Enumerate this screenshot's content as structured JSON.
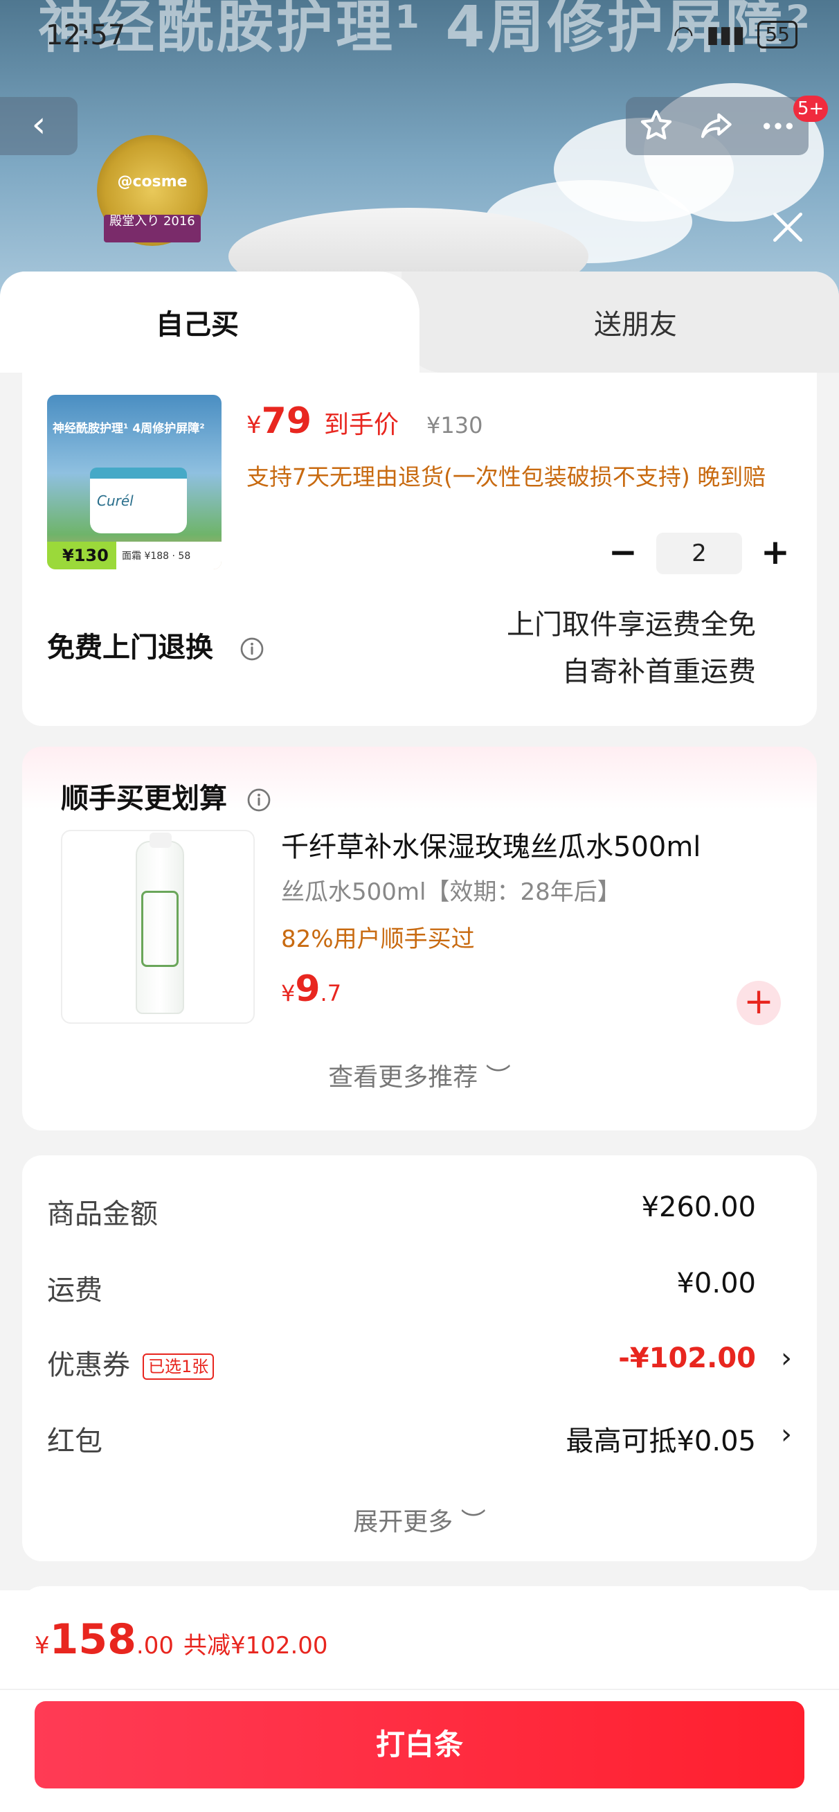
{
  "status_bar": {
    "time": "12:57",
    "battery": "55"
  },
  "banner": {
    "title": "神经酰胺护理¹ 4周修护屏障²",
    "badge_text": "@cosme",
    "badge_ribbon": "殿堂入り 2016"
  },
  "nav": {
    "back_icon": "chevron-left-icon",
    "more_count": "5+"
  },
  "tabs": {
    "self": "自己买",
    "gift": "送朋友"
  },
  "product": {
    "thumb_title": "神经酰胺护理¹ 4周修护屏障²",
    "thumb_brand": "Curél",
    "thumb_price": "¥130",
    "thumb_sub": "面霜 ¥188 · 58",
    "price_currency": "¥",
    "price": "79",
    "price_tag": "到手价",
    "original_price": "¥130",
    "return_note": "支持7天无理由退货(一次性包装破损不支持) 晚到赔",
    "quantity": "2",
    "free_return_label": "免费上门退换",
    "return_line1": "上门取件享运费全免",
    "return_line2": "自寄补首重运费"
  },
  "recommend": {
    "title": "顺手买更划算",
    "name": "千纤草补水保湿玫瑰丝瓜水500ml",
    "spec": "丝瓜水500ml【效期：28年后】",
    "bought": "82%用户顺手买过",
    "price_currency": "¥",
    "price_int": "9",
    "price_dec": ".7",
    "more": "查看更多推荐 ︶"
  },
  "summary": {
    "goods_label": "商品金额",
    "goods_value": "¥260.00",
    "shipping_label": "运费",
    "shipping_value": "¥0.00",
    "coupon_label": "优惠券",
    "coupon_badge": "已选1张",
    "coupon_value": "-¥102.00",
    "redpacket_label": "红包",
    "redpacket_value": "最高可抵¥0.05",
    "expand": "展开更多 ︶"
  },
  "footer": {
    "currency": "¥",
    "total_int": "158",
    "total_dec": ".00",
    "saved": "共减¥102.00",
    "pay_button": "打白条"
  },
  "colors": {
    "accent_red": "#e8261f",
    "orange_text": "#c86a10",
    "button_gradient_start": "#ff3b55",
    "button_gradient_end": "#ff1f2e"
  }
}
